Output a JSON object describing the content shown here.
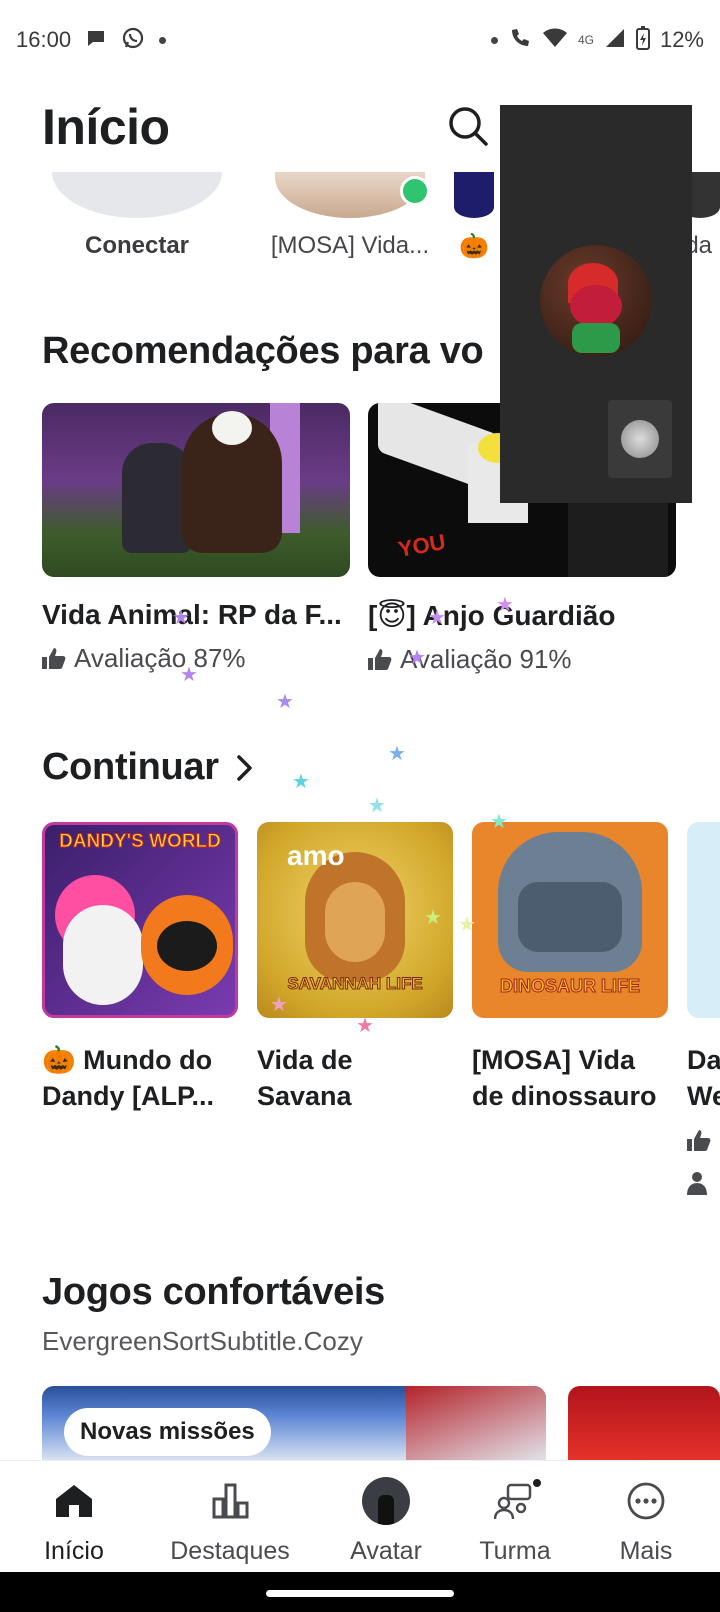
{
  "status_bar": {
    "time": "16:00",
    "network": "4G",
    "battery": "12%"
  },
  "header": {
    "title": "Início"
  },
  "friends": [
    {
      "name": "Conectar"
    },
    {
      "name": "[MOSA] Vida..."
    },
    {
      "name": "🎃"
    },
    {
      "name": "ida"
    }
  ],
  "recommendations": {
    "title": "Recomendações para vo",
    "games": [
      {
        "title": "Vida Animal: RP da F...",
        "rating": "Avaliação 87%"
      },
      {
        "title": "[😇] Anjo Guardião",
        "rating": "Avaliação 91%",
        "thumb_text": "YOU"
      }
    ]
  },
  "continue": {
    "title": "Continuar",
    "games": [
      {
        "title_line1": "🎃 Mundo do",
        "title_line2": "Dandy [ALP...",
        "thumb_text": "DANDY'S WORLD"
      },
      {
        "title_line1": "Vida de",
        "title_line2": "Savana",
        "thumb_text": "SAVANNAH LIFE",
        "thumb_overlay": "amo"
      },
      {
        "title_line1": "[MOSA] Vida",
        "title_line2": "de dinossauro",
        "thumb_text": "DINOSAUR LIFE"
      },
      {
        "title_line1": "Da",
        "title_line2": "We"
      }
    ]
  },
  "cozy": {
    "title": "Jogos confortáveis",
    "subtitle": "EvergreenSortSubtitle.Cozy",
    "badge": "Novas missões"
  },
  "nav": {
    "items": [
      {
        "label": "Início"
      },
      {
        "label": "Destaques"
      },
      {
        "label": "Avatar"
      },
      {
        "label": "Turma"
      },
      {
        "label": "Mais"
      }
    ]
  },
  "colors": {
    "online": "#2fc470",
    "text": "#1e1f21",
    "overlay_bg": "#2b2a2a"
  }
}
